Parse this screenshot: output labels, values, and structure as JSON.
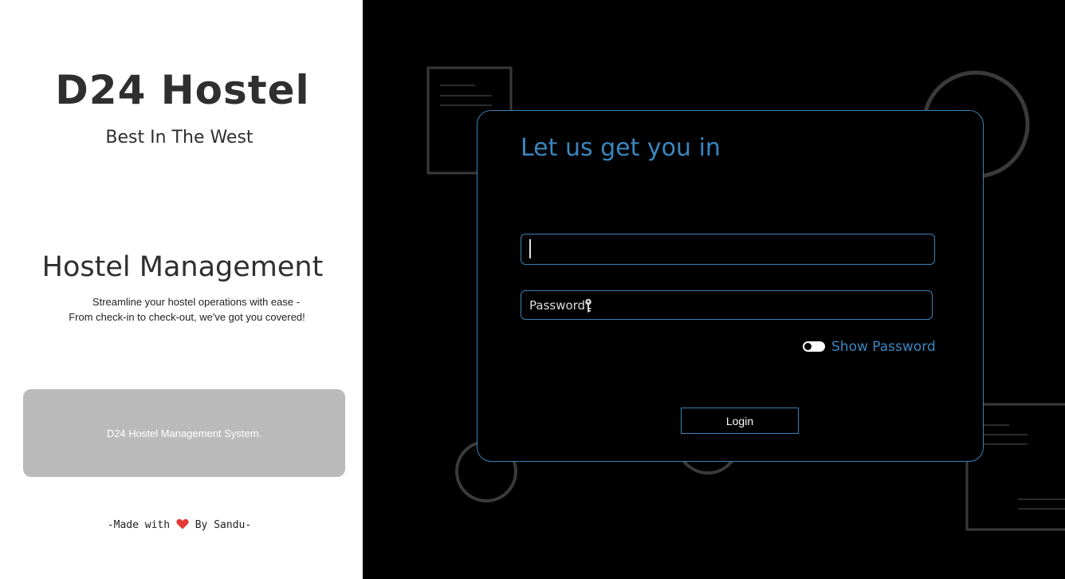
{
  "brand": {
    "title": "D24 Hostel",
    "subtitle": "Best In The West"
  },
  "intro": {
    "heading": "Hostel Management",
    "line1": "Streamline your hostel operations with ease -",
    "line2": "From check-in to check-out, we've got you covered!"
  },
  "system_box": {
    "label": "D24 Hostel Management System."
  },
  "footer": {
    "made_with": "-Made with",
    "by": "By Sandu-"
  },
  "login": {
    "title": "Let us get you in",
    "username_value": "",
    "password_placeholder": "Password",
    "show_password_label": "Show Password",
    "show_password_checked": false,
    "login_button": "Login"
  },
  "colors": {
    "accent": "#3a86c0",
    "left_bg": "#ffffff",
    "right_bg": "#000000",
    "system_box": "#bababa",
    "heart": "#e53935"
  },
  "icons": {
    "key": "key-icon",
    "heart": "heart-icon"
  }
}
